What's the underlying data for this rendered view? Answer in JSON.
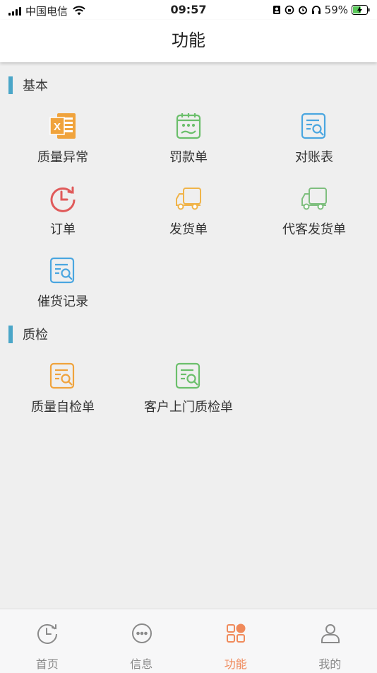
{
  "status_bar": {
    "carrier": "中国电信",
    "time": "09:57",
    "battery": "59%"
  },
  "nav": {
    "title": "功能"
  },
  "sections": [
    {
      "title": "基本",
      "items": [
        {
          "label": "质量异常",
          "icon": "excel-icon",
          "color": "#f0a33c"
        },
        {
          "label": "罚款单",
          "icon": "calendar-hand-icon",
          "color": "#6bbf6b"
        },
        {
          "label": "对账表",
          "icon": "document-search-icon",
          "color": "#4aa6e0"
        },
        {
          "label": "订单",
          "icon": "clock-history-icon",
          "color": "#e05a5a"
        },
        {
          "label": "发货单",
          "icon": "truck-icon",
          "color": "#f0b44a"
        },
        {
          "label": "代客发货单",
          "icon": "truck-icon",
          "color": "#7fbf7f"
        },
        {
          "label": "催货记录",
          "icon": "document-search-icon",
          "color": "#4aa6e0"
        }
      ]
    },
    {
      "title": "质检",
      "items": [
        {
          "label": "质量自检单",
          "icon": "document-search-icon",
          "color": "#f0a33c"
        },
        {
          "label": "客户上门质检单",
          "icon": "document-search-icon",
          "color": "#6bbf6b"
        }
      ]
    }
  ],
  "tabbar": {
    "items": [
      {
        "label": "首页",
        "icon": "clock-home-icon"
      },
      {
        "label": "信息",
        "icon": "chat-dots-icon"
      },
      {
        "label": "功能",
        "icon": "grid-icon",
        "active": true
      },
      {
        "label": "我的",
        "icon": "user-icon"
      }
    ],
    "active_color": "#f08a5b",
    "inactive_color": "#8a8a8a"
  }
}
